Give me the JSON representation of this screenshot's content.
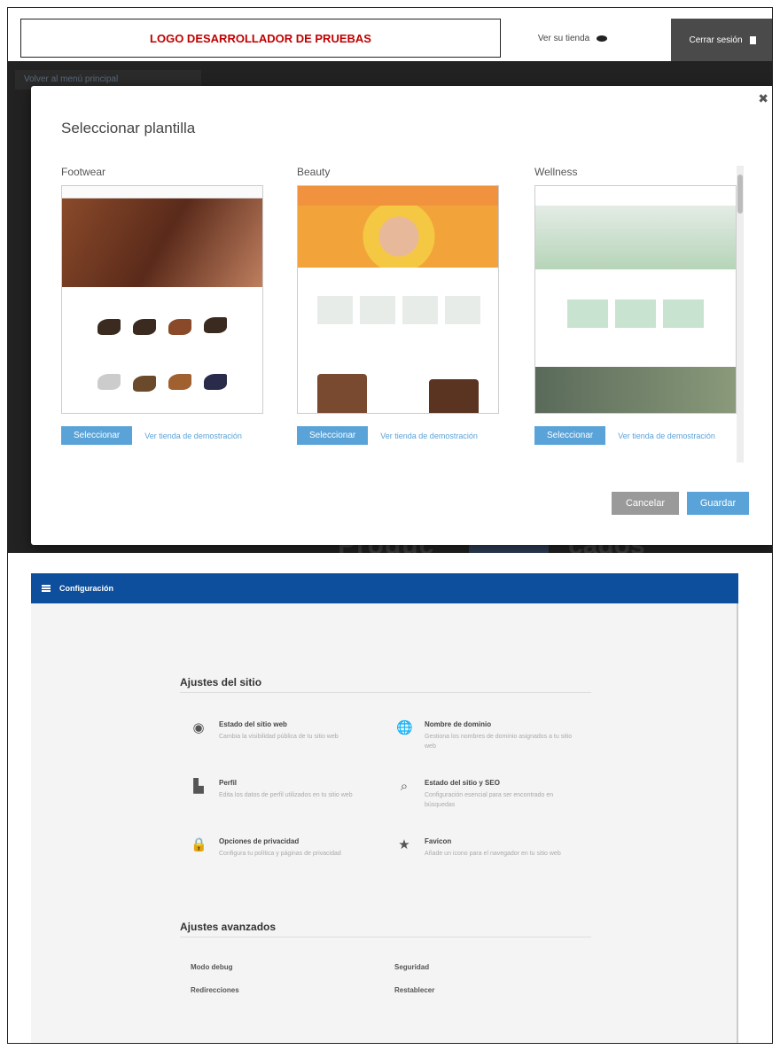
{
  "topbar": {
    "logo": "LOGO DESARROLLADOR DE PRUEBAS",
    "view_store": "Ver su tienda",
    "logout": "Cerrar sesión"
  },
  "back_link": "Volver al menú principal",
  "modal": {
    "title": "Seleccionar plantilla",
    "templates": [
      {
        "name": "Footwear",
        "select": "Seleccionar",
        "demo": "Ver tienda de demostración"
      },
      {
        "name": "Beauty",
        "select": "Seleccionar",
        "demo": "Ver tienda de demostración"
      },
      {
        "name": "Wellness",
        "select": "Seleccionar",
        "demo": "Ver tienda de demostración"
      }
    ],
    "cancel": "Cancelar",
    "save": "Guardar"
  },
  "behind": {
    "left": "Produc",
    "right": "cados"
  },
  "config": {
    "title": "Configuración",
    "site_settings": "Ajustes del sitio",
    "items": [
      {
        "title": "Estado del sitio web",
        "desc": "Cambia la visibilidad pública de tu sitio web",
        "icon": "eye-icon",
        "glyph": "◉"
      },
      {
        "title": "Nombre de dominio",
        "desc": "Gestiona los nombres de dominio asignados a tu sitio web",
        "icon": "globe-icon",
        "glyph": "🌐"
      },
      {
        "title": "Perfil",
        "desc": "Edita los datos de perfil utilizados en tu sitio web",
        "icon": "building-icon",
        "glyph": "▙"
      },
      {
        "title": "Estado del sitio y SEO",
        "desc": "Configuración esencial para ser encontrado en búsquedas",
        "icon": "search-icon",
        "glyph": "⌕"
      },
      {
        "title": "Opciones de privacidad",
        "desc": "Configura tu política y páginas de privacidad",
        "icon": "lock-icon",
        "glyph": "🔒"
      },
      {
        "title": "Favicon",
        "desc": "Añade un icono para el navegador en tu sitio web",
        "icon": "star-icon",
        "glyph": "★"
      }
    ],
    "advanced": "Ajustes avanzados",
    "adv_items": [
      "Modo debug",
      "Seguridad",
      "Redirecciones",
      "Restablecer"
    ]
  }
}
